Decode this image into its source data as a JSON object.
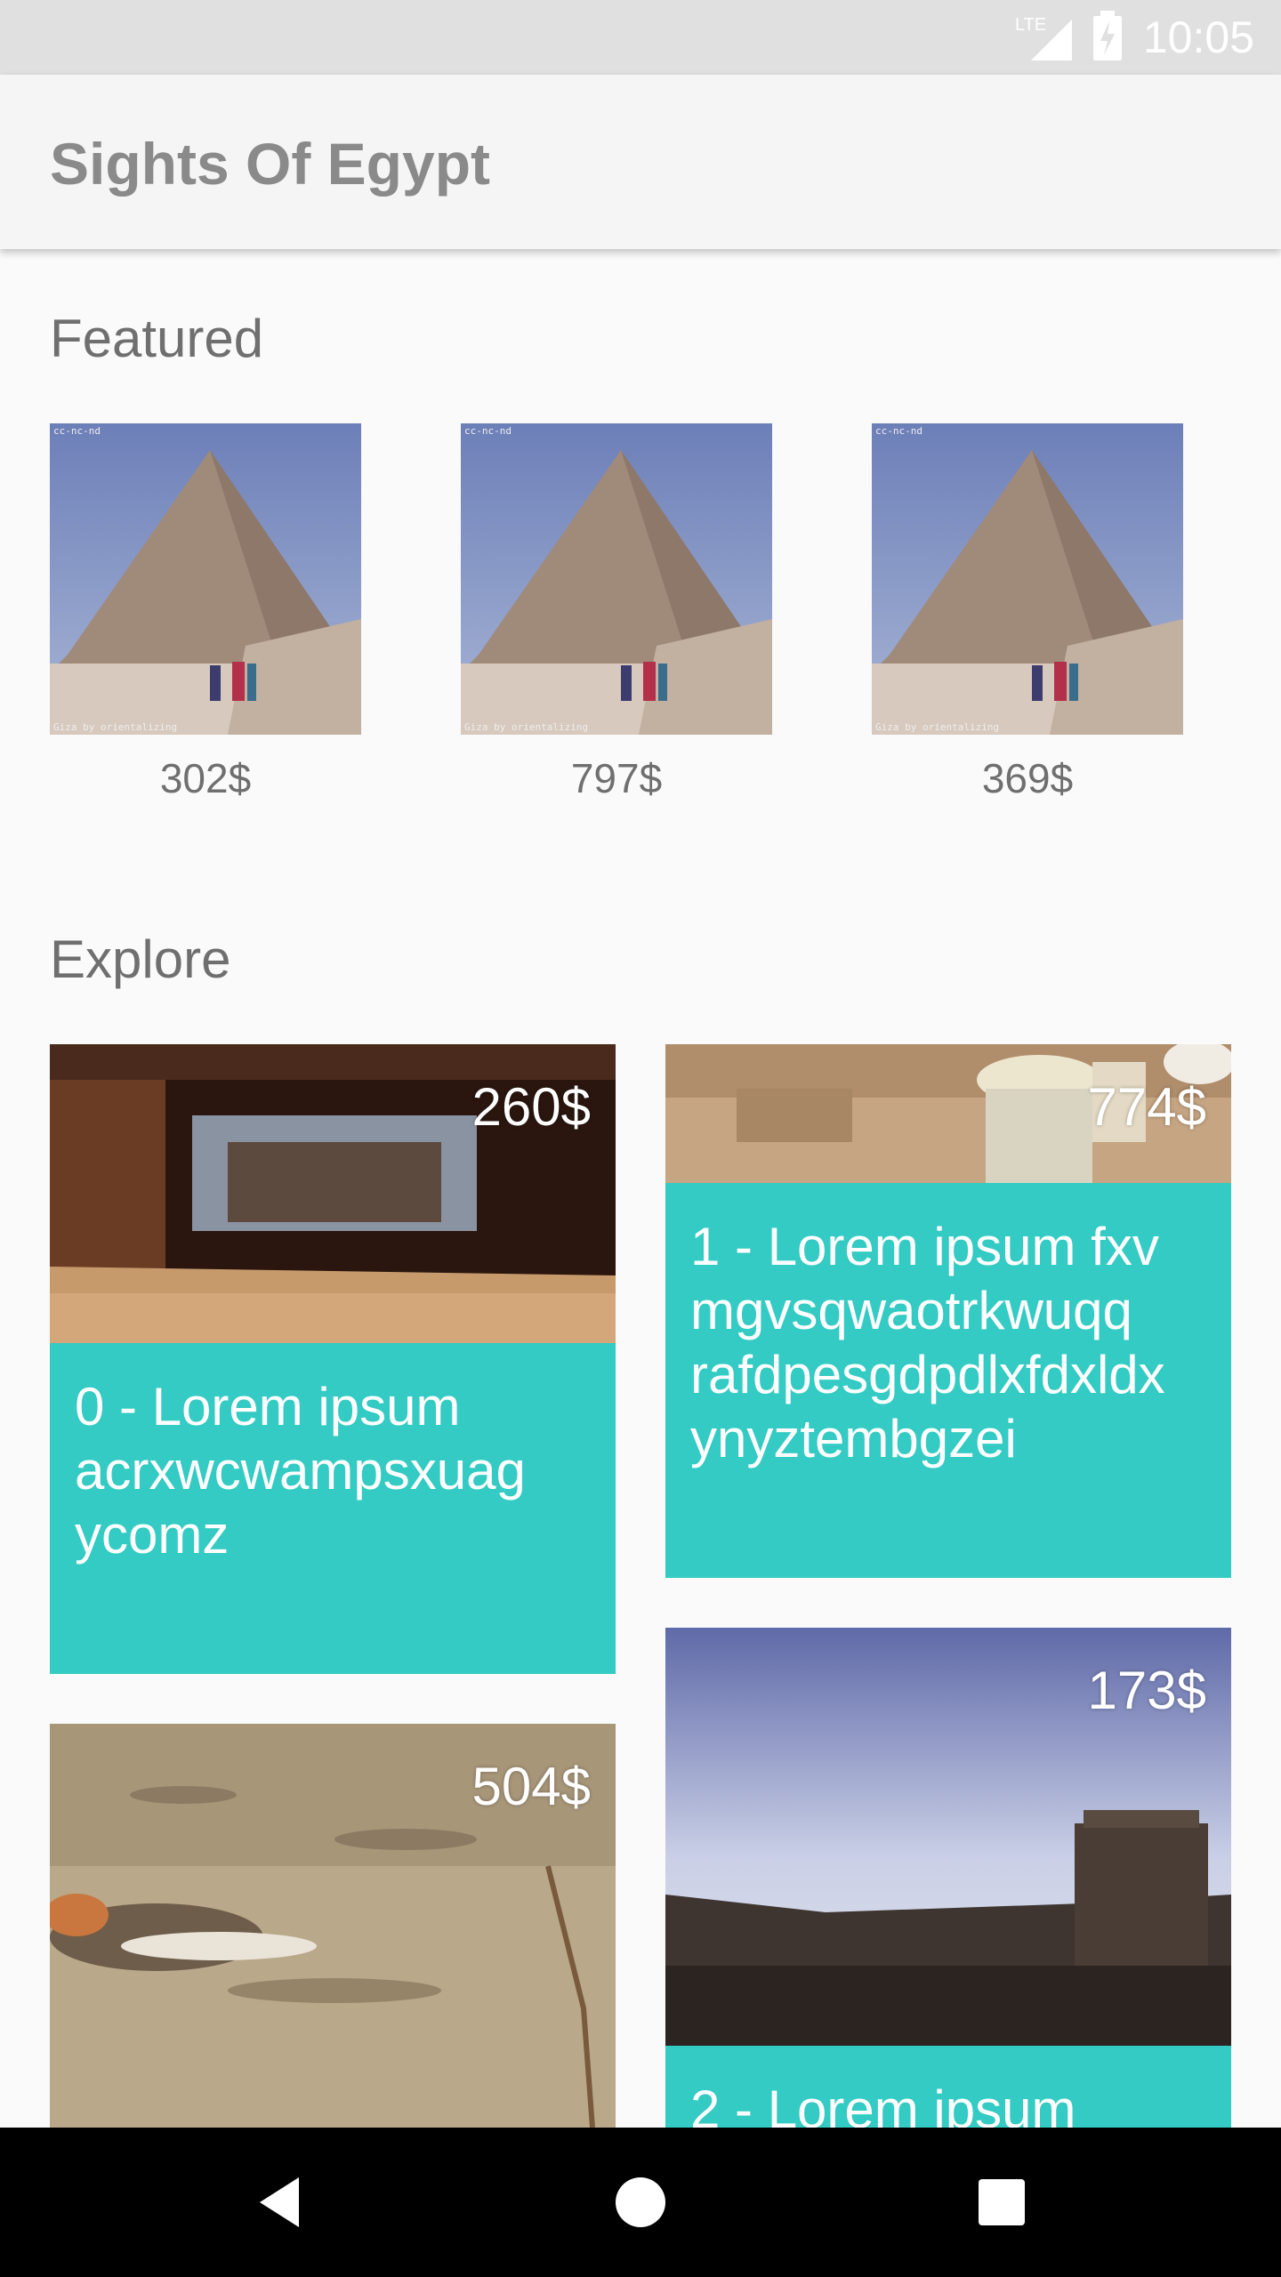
{
  "status_bar": {
    "network": "LTE",
    "time": "10:05"
  },
  "app_bar": {
    "title": "Sights Of Egypt"
  },
  "featured": {
    "title": "Featured",
    "items": [
      {
        "price": "302$",
        "license": "cc-nc-nd",
        "credit": "Giza by orientalizing"
      },
      {
        "price": "797$",
        "license": "cc-nc-nd",
        "credit": "Giza by orientalizing"
      },
      {
        "price": "369$",
        "license": "cc-nc-nd",
        "credit": "Giza by orientalizing"
      }
    ]
  },
  "explore": {
    "title": "Explore",
    "cards": [
      {
        "price": "260$",
        "text": "0 - Lorem ipsum acrxwcwampsxuag ycomz"
      },
      {
        "price": "774$",
        "text": "1 - Lorem ipsum fxv mgvsqwaotrkwuqq rafdpesgdpdlxfdxldx ynyztembgzei"
      },
      {
        "price": "504$",
        "text": ""
      },
      {
        "price": "173$",
        "text": "2 - Lorem ipsum"
      }
    ]
  },
  "colors": {
    "card_body": "#33cbc3",
    "status_bar": "#e0e0e0",
    "app_bar": "#f5f5f5"
  }
}
